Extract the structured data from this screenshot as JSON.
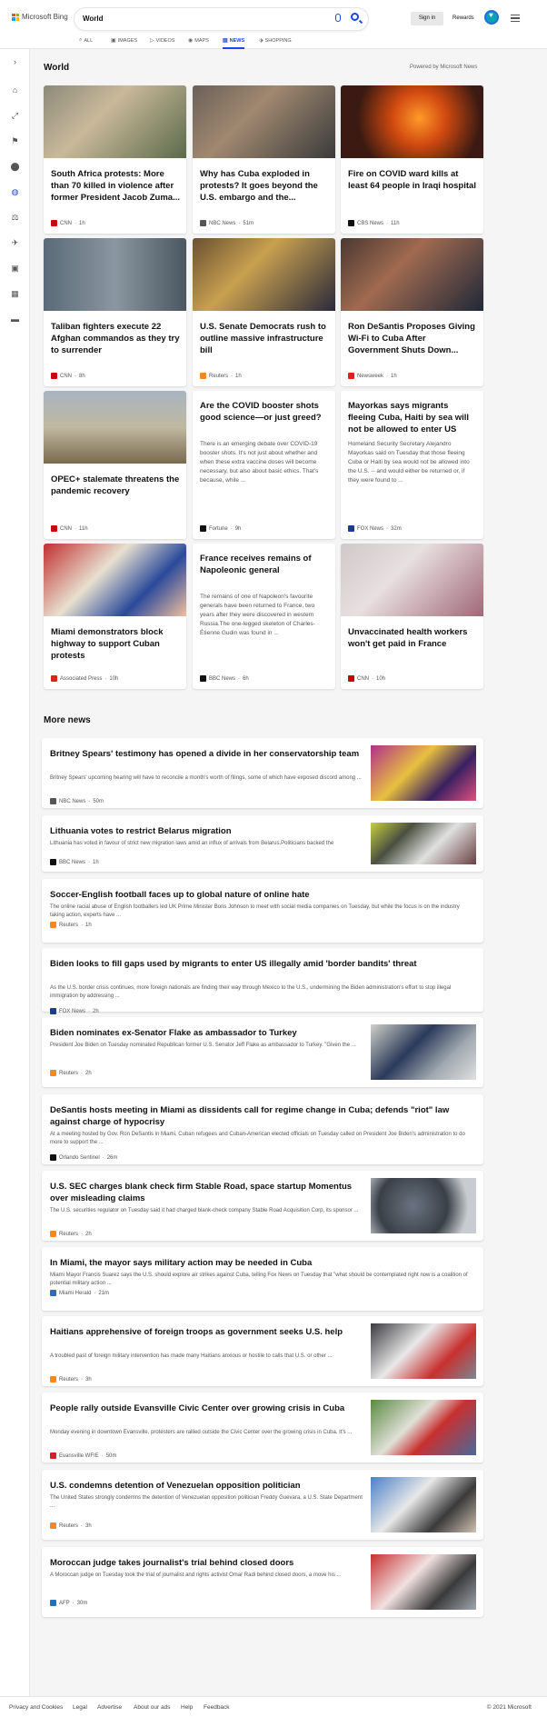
{
  "header": {
    "brand": "Microsoft Bing",
    "search_value": "World",
    "signin": "Sign in",
    "rewards": "Rewards"
  },
  "scopes": [
    {
      "label": "ALL"
    },
    {
      "label": "IMAGES"
    },
    {
      "label": "VIDEOS"
    },
    {
      "label": "MAPS"
    },
    {
      "label": "NEWS"
    },
    {
      "label": "SHOPPING"
    }
  ],
  "section": {
    "title": "World",
    "powered": "Powered by Microsoft News",
    "more": "More news"
  },
  "cards": [
    {
      "title": "South Africa protests: More than 70 killed in violence after former President Jacob Zuma...",
      "snippet": "",
      "source": "CNN",
      "time": "1h",
      "source_color": "#cc0000"
    },
    {
      "title": "Why has Cuba exploded in protests? It goes beyond the U.S. embargo and the...",
      "snippet": "",
      "source": "NBC News",
      "time": "51m",
      "source_color": "#555555"
    },
    {
      "title": "Fire on COVID ward kills at least 64 people in Iraqi hospital",
      "snippet": "",
      "source": "CBS News",
      "time": "11h",
      "source_color": "#111111"
    },
    {
      "title": "Taliban fighters execute 22 Afghan commandos as they try to surrender",
      "snippet": "",
      "source": "CNN",
      "time": "8h",
      "source_color": "#cc0000"
    },
    {
      "title": "U.S. Senate Democrats rush to outline massive infrastructure bill",
      "snippet": "",
      "source": "Reuters",
      "time": "1h",
      "source_color": "#f08a24"
    },
    {
      "title": "Ron DeSantis Proposes Giving Wi-Fi to Cuba After Government Shuts Down...",
      "snippet": "",
      "source": "Newsweek",
      "time": "1h",
      "source_color": "#e0201b"
    },
    {
      "title": "OPEC+ stalemate threatens the pandemic recovery",
      "snippet": "",
      "source": "CNN",
      "time": "11h",
      "source_color": "#cc0000"
    },
    {
      "title": "Are the COVID booster shots good science—or just greed?",
      "snippet": "There is an emerging debate over COVID-19 booster shots. It's not just about whether and when these extra vaccine doses will become necessary, but also about basic ethics. That's because, while ...",
      "source": "Fortune",
      "time": "9h",
      "source_color": "#111111"
    },
    {
      "title": "Mayorkas says migrants fleeing Cuba, Haiti by sea will not be allowed to enter US",
      "snippet": "Homeland Security Secretary Alejandro Mayorkas said on Tuesday that those fleeing Cuba or Haiti by sea would not be allowed into the U.S. -- and would either be returned or, if they were found to ...",
      "source": "FOX News",
      "time": "32m",
      "source_color": "#1a3d8f"
    },
    {
      "title": "Miami demonstrators block highway to support Cuban protests",
      "snippet": "",
      "source": "Associated Press",
      "time": "10h",
      "source_color": "#e0201b"
    },
    {
      "title": "France receives remains of Napoleonic general",
      "snippet": "The remains of one of Napoleon's favourite generals have been returned to France, two years after they were discovered in western Russia.The one-legged skeleton of Charles-Étienne Gudin was found in ...",
      "source": "BBC News",
      "time": "6h",
      "source_color": "#111111"
    },
    {
      "title": "Unvaccinated health workers won't get paid in France",
      "snippet": "",
      "source": "CNN",
      "time": "10h",
      "source_color": "#cc0000"
    }
  ],
  "more_news": [
    {
      "title": "Britney Spears' testimony has opened a divide in her conservatorship team",
      "snippet": "Britney Spears' upcoming hearing will have to reconcile a month's worth of filings, some of which have exposed discord among ...",
      "source": "NBC News",
      "time": "50m",
      "source_color": "#555555"
    },
    {
      "title": "Lithuania votes to restrict Belarus migration",
      "snippet": "Lithuania has voted in favour of strict new migration laws amid an influx of arrivals from Belarus.Politicians backed the",
      "source": "BBC News",
      "time": "1h",
      "source_color": "#111111"
    },
    {
      "title": "Soccer-English football faces up to global nature of online hate",
      "snippet": "The online racial abuse of English footballers led UK Prime Minister Boris Johnson to meet with social media companies on Tuesday, but while the focus is on the industry taking action, experts have ...",
      "source": "Reuters",
      "time": "1h",
      "source_color": "#f08a24"
    },
    {
      "title": "Biden looks to fill gaps used by migrants to enter US illegally amid 'border bandits' threat",
      "snippet": "As the U.S. border crisis continues, more foreign nationals are finding their way through Mexico to the U.S., undermining the Biden administration's effort to stop illegal immigration by addressing ...",
      "source": "FOX News",
      "time": "2h",
      "source_color": "#1a3d8f"
    },
    {
      "title": "Biden nominates ex-Senator Flake as ambassador to Turkey",
      "snippet": "President Joe Biden on Tuesday nominated Republican former U.S. Senator Jeff Flake as ambassador to Turkey. \"Given the ...",
      "source": "Reuters",
      "time": "2h",
      "source_color": "#f08a24"
    },
    {
      "title": "DeSantis hosts meeting in Miami as dissidents call for regime change in Cuba; defends \"riot\" law against charge of hypocrisy",
      "snippet": "At a meeting hosted by Gov. Ron DeSantis in Miami, Cuban refugees and Cuban-American elected officials on Tuesday called on President Joe Biden's administration to do more to support the ...",
      "source": "Orlando Sentinel",
      "time": "26m",
      "source_color": "#111111"
    },
    {
      "title": "U.S. SEC charges blank check firm Stable Road, space startup Momentus over misleading claims",
      "snippet": "The U.S. securities regulator on Tuesday said it had charged blank-check company Stable Road Acquisition Corp, its sponsor ...",
      "source": "Reuters",
      "time": "2h",
      "source_color": "#f08a24"
    },
    {
      "title": "In Miami, the mayor says military action may be needed in Cuba",
      "snippet": "Miami Mayor Francis Suarez says the U.S. should explore air strikes against Cuba, telling Fox News on Tuesday that \"what should be contemplated right now is a coalition of potential military action ...",
      "source": "Miami Herald",
      "time": "21m",
      "source_color": "#2a6fb5"
    },
    {
      "title": "Haitians apprehensive of foreign troops as government seeks U.S. help",
      "snippet": "A troubled past of foreign military intervention has made many Haitians anxious or hostile to calls that U.S. or other ...",
      "source": "Reuters",
      "time": "3h",
      "source_color": "#f08a24"
    },
    {
      "title": "People rally outside Evansville Civic Center over growing crisis in Cuba",
      "snippet": "Monday evening in downtown Evansville, protesters are rallied outside the Civic Center over the growing crisis in Cuba. It's ...",
      "source": "Evansville WFIE",
      "time": "50m",
      "source_color": "#d0202c"
    },
    {
      "title": "U.S. condemns detention of Venezuelan opposition politician",
      "snippet": "The United States strongly condemns the detention of Venezuelan opposition politician Freddy Guevara, a U.S. State Department ...",
      "source": "Reuters",
      "time": "3h",
      "source_color": "#f08a24"
    },
    {
      "title": "Moroccan judge takes journalist's trial behind closed doors",
      "snippet": "A Moroccan judge on Tuesday took the trial of journalist and rights activist Omar Radi behind closed doors, a move his ...",
      "source": "AFP",
      "time": "30m",
      "source_color": "#2a6fb5"
    }
  ],
  "footer": {
    "links": [
      "Privacy and Cookies",
      "Legal",
      "Advertise",
      "About our ads",
      "Help",
      "Feedback"
    ],
    "copyright": "© 2021 Microsoft"
  }
}
